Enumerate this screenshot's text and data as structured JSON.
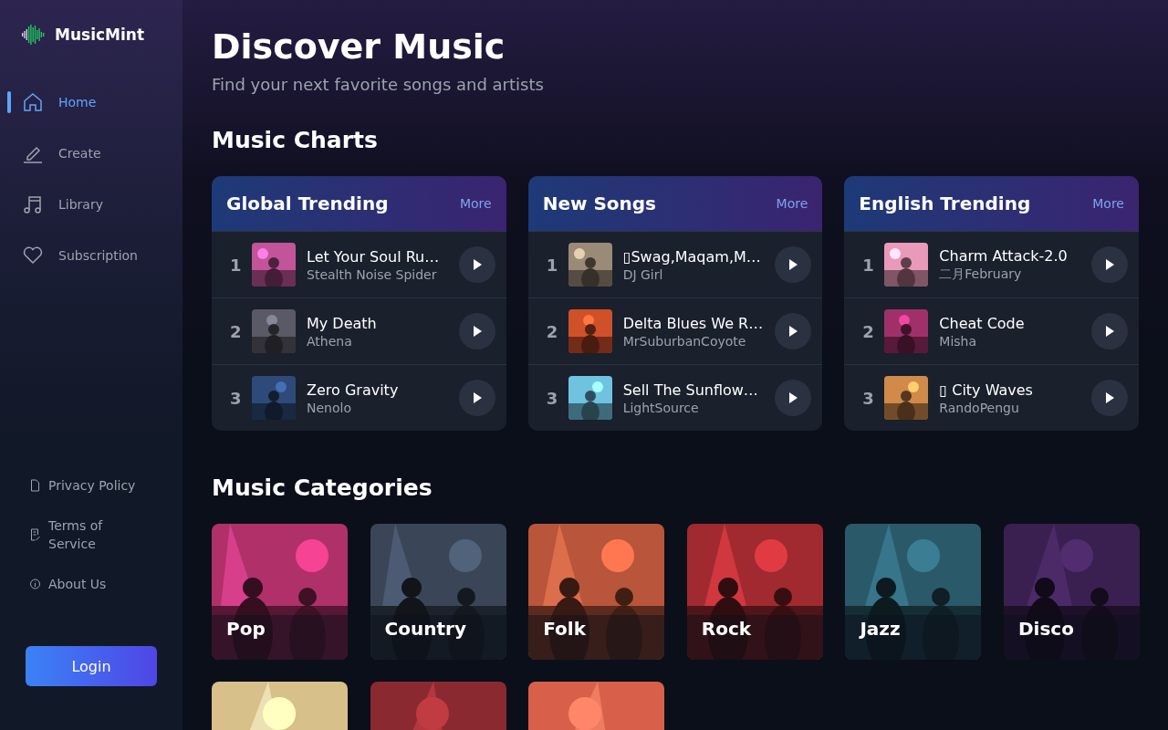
{
  "brand": {
    "name": "MusicMint"
  },
  "nav": [
    {
      "label": "Home",
      "selected": true
    },
    {
      "label": "Create",
      "selected": false
    },
    {
      "label": "Library",
      "selected": false
    },
    {
      "label": "Subscription",
      "selected": false
    }
  ],
  "footer_links": [
    {
      "label": "Privacy Policy"
    },
    {
      "label": "Terms of Service"
    },
    {
      "label": "About Us"
    }
  ],
  "login_button": "Login",
  "header": {
    "title": "Discover Music",
    "subtitle": "Find your next favorite songs and artists"
  },
  "charts_section": {
    "title": "Music Charts",
    "charts": [
      {
        "title": "Global Trending",
        "more": "More",
        "songs": [
          {
            "rank": "1",
            "title": "Let Your Soul Ru…",
            "artist": "Stealth Noise Spider",
            "color": "#c2549a"
          },
          {
            "rank": "2",
            "title": "My Death",
            "artist": "Athena",
            "color": "#5a5a66"
          },
          {
            "rank": "3",
            "title": "Zero Gravity",
            "artist": "Nenolo",
            "color": "#2e4a78"
          }
        ]
      },
      {
        "title": "New Songs",
        "more": "More",
        "songs": [
          {
            "rank": "1",
            "title": "▯Swag,Maqam,M…",
            "artist": "DJ Girl",
            "color": "#9a8a78"
          },
          {
            "rank": "2",
            "title": "Delta Blues We R…",
            "artist": "MrSuburbanCoyote",
            "color": "#d0502a"
          },
          {
            "rank": "3",
            "title": "Sell The Sunflow…",
            "artist": "LightSource",
            "color": "#6fc3e0"
          }
        ]
      },
      {
        "title": "English Trending",
        "more": "More",
        "songs": [
          {
            "rank": "1",
            "title": "Charm Attack-2.0",
            "artist": "二月February",
            "color": "#e89ab8"
          },
          {
            "rank": "2",
            "title": "Cheat Code",
            "artist": "Misha",
            "color": "#a0306a"
          },
          {
            "rank": "3",
            "title": "▯ City Waves",
            "artist": "RandoPengu",
            "color": "#d08a4a"
          }
        ]
      }
    ]
  },
  "categories_section": {
    "title": "Music Categories",
    "categories": [
      {
        "name": "Pop",
        "color": "#b0306a"
      },
      {
        "name": "Country",
        "color": "#3a4658"
      },
      {
        "name": "Folk",
        "color": "#b8553a"
      },
      {
        "name": "Rock",
        "color": "#a02a30"
      },
      {
        "name": "Jazz",
        "color": "#2a5a6a"
      },
      {
        "name": "Disco",
        "color": "#3a2050"
      },
      {
        "color": "#d8c08a"
      },
      {
        "color": "#8a2a30"
      },
      {
        "color": "#d8604a"
      }
    ]
  }
}
